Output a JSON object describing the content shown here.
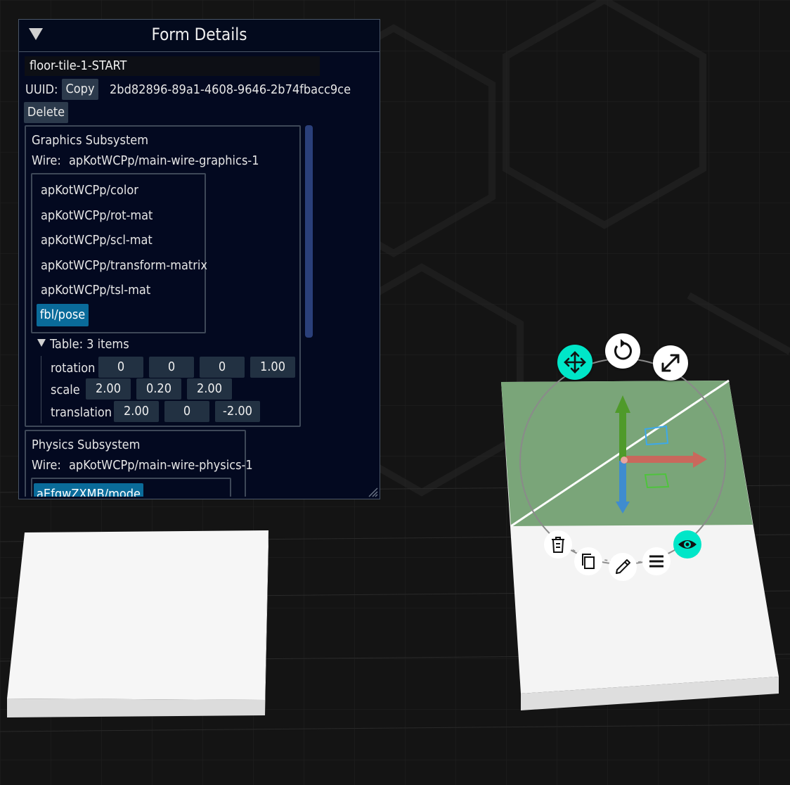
{
  "panel": {
    "title": "Form Details",
    "name_value": "floor-tile-1-START",
    "uuid_label": "UUID:",
    "copy_label": "Copy",
    "uuid_value": "2bd82896-89a1-4608-9646-2b74fbacc9ce",
    "delete_label": "Delete"
  },
  "graphics": {
    "heading": "Graphics Subsystem",
    "wire_label": "Wire:",
    "wire_value": "apKotWCPp/main-wire-graphics-1",
    "items": [
      "apKotWCPp/color",
      "apKotWCPp/rot-mat",
      "apKotWCPp/scl-mat",
      "apKotWCPp/transform-matrix",
      "apKotWCPp/tsl-mat",
      "fbl/pose"
    ],
    "table_header": "Table: 3 items",
    "rows": [
      {
        "label": "rotation",
        "values": [
          "0",
          "0",
          "0",
          "1.00"
        ]
      },
      {
        "label": "scale",
        "values": [
          "2.00",
          "0.20",
          "2.00"
        ]
      },
      {
        "label": "translation",
        "values": [
          "2.00",
          "0",
          "-2.00"
        ]
      }
    ]
  },
  "physics": {
    "heading": "Physics Subsystem",
    "wire_label": "Wire:",
    "wire_value": "apKotWCPp/main-wire-physics-1",
    "first_item": "aEfqwZXMB/mode"
  },
  "gizmo": {
    "modes": [
      "move-icon",
      "rotate-icon",
      "scale-icon"
    ],
    "active_mode": "move-icon",
    "actions": [
      "trash-icon",
      "copy-icon",
      "pencil-icon",
      "menu-icon",
      "eye-icon"
    ],
    "active_action": "eye-icon",
    "axis_colors": {
      "x": "#c9685c",
      "y": "#4f9a2a",
      "z": "#3f8ccf"
    }
  },
  "colors": {
    "background": "#131313",
    "panel_bg": "#030920",
    "accent": "#00e6c8",
    "selected_item": "#0a6b9a",
    "tile_white": "#f5f5f5",
    "tile_selected": "#7aa579"
  }
}
